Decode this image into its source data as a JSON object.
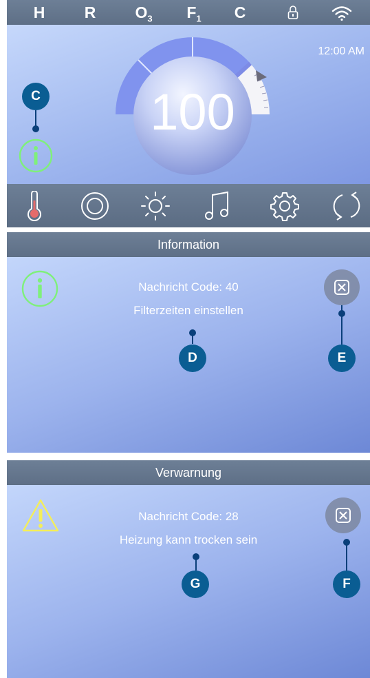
{
  "status_bar": {
    "h": "H",
    "r": "R",
    "ozone": "O",
    "ozone_sub": "3",
    "filter": "F",
    "filter_sub": "1",
    "c": "C",
    "lock_icon": "lock-icon",
    "wifi_icon": "wifi-icon"
  },
  "main": {
    "time": "12:00 AM",
    "temperature": "100",
    "callout": "C"
  },
  "nav": [
    "thermometer-icon",
    "jets-icon",
    "light-icon",
    "music-icon",
    "gear-icon",
    "refresh-icon"
  ],
  "info_panel": {
    "title": "Information",
    "code_text": "Nachricht Code: 40",
    "message": "Filterzeiten einstellen",
    "callout_message": "D",
    "callout_close": "E"
  },
  "warning_panel": {
    "title": "Verwarnung",
    "code_text": "Nachricht Code: 28",
    "message": "Heizung kann trocken sein",
    "callout_message": "G",
    "callout_close": "F"
  },
  "colors": {
    "bar": "#66788f",
    "gauge_fill": "#7f93ee",
    "info_green": "#7ff07a",
    "warning_yellow": "#f4ee5a",
    "callout": "#0a5d93"
  }
}
